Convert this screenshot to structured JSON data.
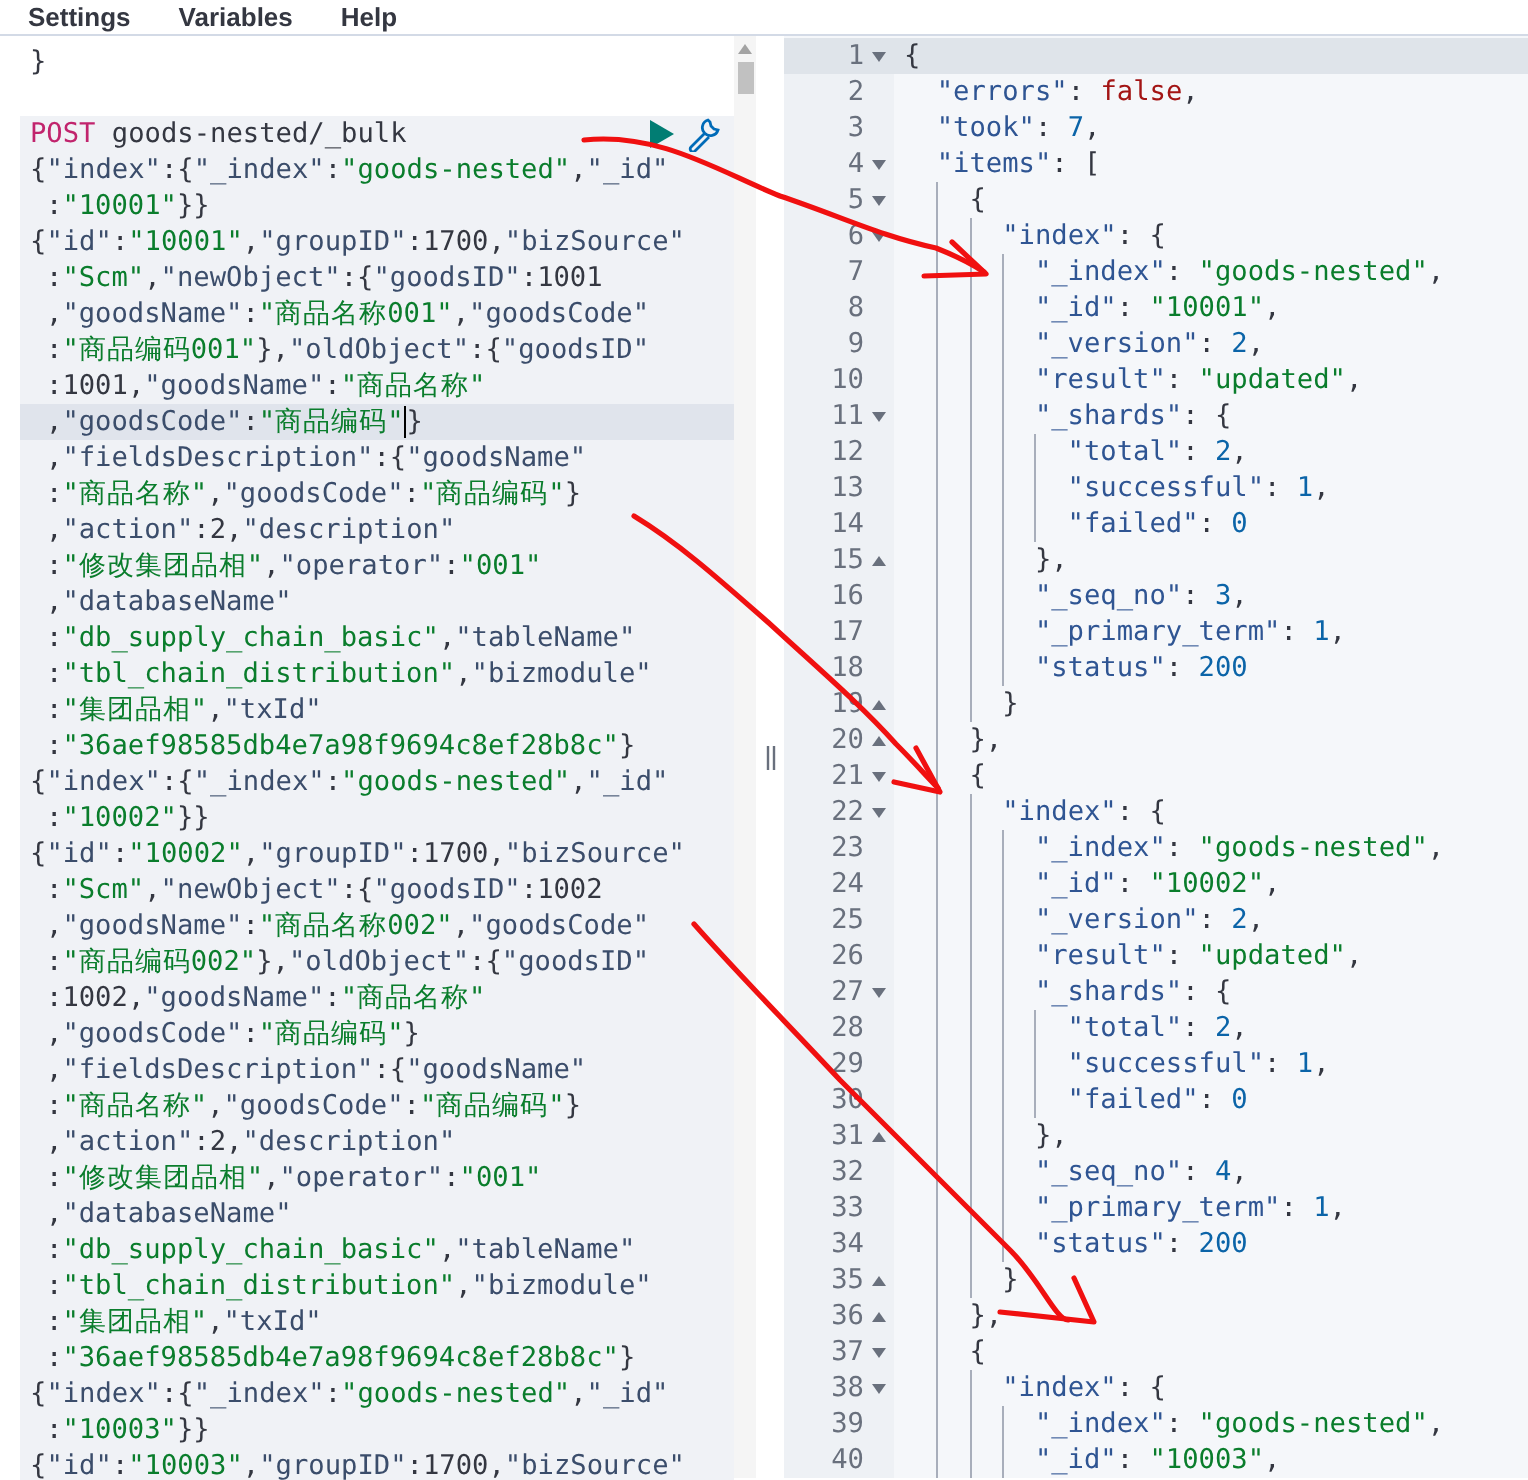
{
  "menu": [
    "Settings",
    "Variables",
    "Help"
  ],
  "request_editor": {
    "lines": [
      {
        "kind": "code",
        "text": "}",
        "wrapped": false
      },
      {
        "kind": "blank"
      },
      {
        "kind": "request",
        "method": "POST",
        "path": "goods-nested/_bulk"
      },
      {
        "kind": "code",
        "text": "{\"index\":{\"_index\":\"goods-nested\",\"_id\"",
        "wrapped": false
      },
      {
        "kind": "code",
        "text": ":\"10001\"}}",
        "wrapped": true
      },
      {
        "kind": "code",
        "text": "{\"id\":\"10001\",\"groupID\":1700,\"bizSource\"",
        "wrapped": false
      },
      {
        "kind": "code",
        "text": ":\"Scm\",\"newObject\":{\"goodsID\":1001",
        "wrapped": true
      },
      {
        "kind": "code",
        "text": ",\"goodsName\":\"商品名称001\",\"goodsCode\"",
        "wrapped": true
      },
      {
        "kind": "code",
        "text": ":\"商品编码001\"},\"oldObject\":{\"goodsID\"",
        "wrapped": true
      },
      {
        "kind": "code",
        "text": ":1001,\"goodsName\":\"商品名称\"",
        "wrapped": true
      },
      {
        "kind": "code",
        "text": ",\"goodsCode\":\"商品编码\"",
        "after_cursor": "}",
        "active": true,
        "wrapped": true
      },
      {
        "kind": "code",
        "text": ",\"fieldsDescription\":{\"goodsName\"",
        "wrapped": true
      },
      {
        "kind": "code",
        "text": ":\"商品名称\",\"goodsCode\":\"商品编码\"}",
        "wrapped": true
      },
      {
        "kind": "code",
        "text": ",\"action\":2,\"description\"",
        "wrapped": true
      },
      {
        "kind": "code",
        "text": ":\"修改集团品相\",\"operator\":\"001\"",
        "wrapped": true
      },
      {
        "kind": "code",
        "text": ",\"databaseName\"",
        "wrapped": true
      },
      {
        "kind": "code",
        "text": ":\"db_supply_chain_basic\",\"tableName\"",
        "wrapped": true
      },
      {
        "kind": "code",
        "text": ":\"tbl_chain_distribution\",\"bizmodule\"",
        "wrapped": true
      },
      {
        "kind": "code",
        "text": ":\"集团品相\",\"txId\"",
        "wrapped": true
      },
      {
        "kind": "code",
        "text": ":\"36aef98585db4e7a98f9694c8ef28b8c\"}",
        "wrapped": true
      },
      {
        "kind": "code",
        "text": "{\"index\":{\"_index\":\"goods-nested\",\"_id\"",
        "wrapped": false
      },
      {
        "kind": "code",
        "text": ":\"10002\"}}",
        "wrapped": true
      },
      {
        "kind": "code",
        "text": "{\"id\":\"10002\",\"groupID\":1700,\"bizSource\"",
        "wrapped": false
      },
      {
        "kind": "code",
        "text": ":\"Scm\",\"newObject\":{\"goodsID\":1002",
        "wrapped": true
      },
      {
        "kind": "code",
        "text": ",\"goodsName\":\"商品名称002\",\"goodsCode\"",
        "wrapped": true
      },
      {
        "kind": "code",
        "text": ":\"商品编码002\"},\"oldObject\":{\"goodsID\"",
        "wrapped": true
      },
      {
        "kind": "code",
        "text": ":1002,\"goodsName\":\"商品名称\"",
        "wrapped": true
      },
      {
        "kind": "code",
        "text": ",\"goodsCode\":\"商品编码\"}",
        "wrapped": true
      },
      {
        "kind": "code",
        "text": ",\"fieldsDescription\":{\"goodsName\"",
        "wrapped": true
      },
      {
        "kind": "code",
        "text": ":\"商品名称\",\"goodsCode\":\"商品编码\"}",
        "wrapped": true
      },
      {
        "kind": "code",
        "text": ",\"action\":2,\"description\"",
        "wrapped": true
      },
      {
        "kind": "code",
        "text": ":\"修改集团品相\",\"operator\":\"001\"",
        "wrapped": true
      },
      {
        "kind": "code",
        "text": ",\"databaseName\"",
        "wrapped": true
      },
      {
        "kind": "code",
        "text": ":\"db_supply_chain_basic\",\"tableName\"",
        "wrapped": true
      },
      {
        "kind": "code",
        "text": ":\"tbl_chain_distribution\",\"bizmodule\"",
        "wrapped": true
      },
      {
        "kind": "code",
        "text": ":\"集团品相\",\"txId\"",
        "wrapped": true
      },
      {
        "kind": "code",
        "text": ":\"36aef98585db4e7a98f9694c8ef28b8c\"}",
        "wrapped": true
      },
      {
        "kind": "code",
        "text": "{\"index\":{\"_index\":\"goods-nested\",\"_id\"",
        "wrapped": false
      },
      {
        "kind": "code",
        "text": ":\"10003\"}}",
        "wrapped": true
      },
      {
        "kind": "code",
        "text": "{\"id\":\"10003\",\"groupID\":1700,\"bizSource\"",
        "wrapped": false
      }
    ]
  },
  "response_viewer": {
    "lines": [
      {
        "number": "1",
        "text": "{",
        "kind": "block_start",
        "active": true
      },
      {
        "number": "2",
        "text": "  \"errors\": false,",
        "kind": "plain",
        "active": false
      },
      {
        "number": "3",
        "text": "  \"took\": 7,",
        "kind": "plain",
        "active": false
      },
      {
        "number": "4",
        "text": "  \"items\": [",
        "kind": "block_start",
        "active": false
      },
      {
        "number": "5",
        "text": "    {",
        "kind": "block_start",
        "active": false
      },
      {
        "number": "6",
        "text": "      \"index\": {",
        "kind": "block_start",
        "active": false
      },
      {
        "number": "7",
        "text": "        \"_index\": \"goods-nested\",",
        "kind": "plain",
        "active": false
      },
      {
        "number": "8",
        "text": "        \"_id\": \"10001\",",
        "kind": "plain",
        "active": false
      },
      {
        "number": "9",
        "text": "        \"_version\": 2,",
        "kind": "plain",
        "active": false
      },
      {
        "number": "10",
        "text": "        \"result\": \"updated\",",
        "kind": "plain",
        "active": false
      },
      {
        "number": "11",
        "text": "        \"_shards\": {",
        "kind": "block_start",
        "active": false
      },
      {
        "number": "12",
        "text": "          \"total\": 2,",
        "kind": "plain",
        "active": false
      },
      {
        "number": "13",
        "text": "          \"successful\": 1,",
        "kind": "plain",
        "active": false
      },
      {
        "number": "14",
        "text": "          \"failed\": 0",
        "kind": "plain",
        "active": false
      },
      {
        "number": "15",
        "text": "        },",
        "kind": "block_end",
        "active": false
      },
      {
        "number": "16",
        "text": "        \"_seq_no\": 3,",
        "kind": "plain",
        "active": false
      },
      {
        "number": "17",
        "text": "        \"_primary_term\": 1,",
        "kind": "plain",
        "active": false
      },
      {
        "number": "18",
        "text": "        \"status\": 200",
        "kind": "plain",
        "active": false
      },
      {
        "number": "19",
        "text": "      }",
        "kind": "block_end",
        "active": false
      },
      {
        "number": "20",
        "text": "    },",
        "kind": "block_end",
        "active": false
      },
      {
        "number": "21",
        "text": "    {",
        "kind": "block_start",
        "active": false
      },
      {
        "number": "22",
        "text": "      \"index\": {",
        "kind": "block_start",
        "active": false
      },
      {
        "number": "23",
        "text": "        \"_index\": \"goods-nested\",",
        "kind": "plain",
        "active": false
      },
      {
        "number": "24",
        "text": "        \"_id\": \"10002\",",
        "kind": "plain",
        "active": false
      },
      {
        "number": "25",
        "text": "        \"_version\": 2,",
        "kind": "plain",
        "active": false
      },
      {
        "number": "26",
        "text": "        \"result\": \"updated\",",
        "kind": "plain",
        "active": false
      },
      {
        "number": "27",
        "text": "        \"_shards\": {",
        "kind": "block_start",
        "active": false
      },
      {
        "number": "28",
        "text": "          \"total\": 2,",
        "kind": "plain",
        "active": false
      },
      {
        "number": "29",
        "text": "          \"successful\": 1,",
        "kind": "plain",
        "active": false
      },
      {
        "number": "30",
        "text": "          \"failed\": 0",
        "kind": "plain",
        "active": false
      },
      {
        "number": "31",
        "text": "        },",
        "kind": "block_end",
        "active": false
      },
      {
        "number": "32",
        "text": "        \"_seq_no\": 4,",
        "kind": "plain",
        "active": false
      },
      {
        "number": "33",
        "text": "        \"_primary_term\": 1,",
        "kind": "plain",
        "active": false
      },
      {
        "number": "34",
        "text": "        \"status\": 200",
        "kind": "plain",
        "active": false
      },
      {
        "number": "35",
        "text": "      }",
        "kind": "block_end",
        "active": false
      },
      {
        "number": "36",
        "text": "    },",
        "kind": "block_end",
        "active": false
      },
      {
        "number": "37",
        "text": "    {",
        "kind": "block_start",
        "active": false
      },
      {
        "number": "38",
        "text": "      \"index\": {",
        "kind": "block_start",
        "active": false
      },
      {
        "number": "39",
        "text": "        \"_index\": \"goods-nested\",",
        "kind": "plain",
        "active": false
      },
      {
        "number": "40",
        "text": "        \"_id\": \"10003\",",
        "kind": "plain",
        "active": false
      }
    ]
  },
  "annotations": [
    {
      "kind": "arrow"
    },
    {
      "kind": "arrow"
    },
    {
      "kind": "arrow"
    }
  ]
}
